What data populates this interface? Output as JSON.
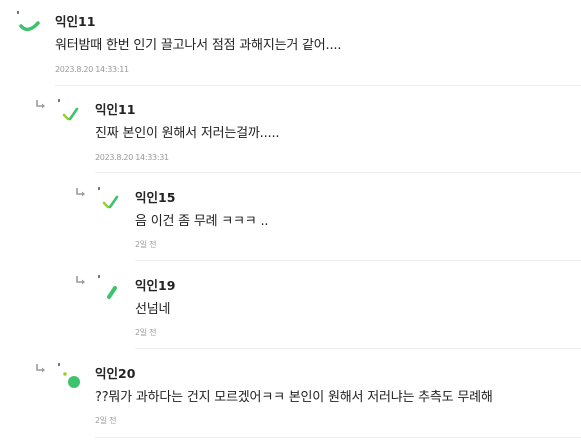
{
  "comments": [
    {
      "nickname": "익인11",
      "text": "워터밤때 한번 인기 끌고나서 점점 과해지는거 같어....",
      "time": "2023.8.20 14:33:11",
      "avatar_icon": "green-arc-avatar-icon"
    },
    {
      "nickname": "익인11",
      "text": "진짜 본인이 원해서 저러는걸까.....",
      "time": "2023.8.20 14:33:31",
      "avatar_icon": "green-dashes-avatar-icon"
    },
    {
      "nickname": "익인15",
      "text": "음 이건 좀 무례 ㅋㅋㅋ ..",
      "time": "2일 전",
      "avatar_icon": "green-dashes-avatar-icon"
    },
    {
      "nickname": "익인19",
      "text": "선넘네",
      "time": "2일 전",
      "avatar_icon": "green-bar-avatar-icon"
    },
    {
      "nickname": "익인20",
      "text": "??뭐가 과하다는 건지 모르겠어ㅋㅋ 본인이 원해서 저러냐는 추측도 무례해",
      "time": "2일 전",
      "avatar_icon": "green-dot-avatar-icon"
    }
  ],
  "reply_icon": "reply-arrow-icon",
  "colors": {
    "accent_green": "#3cc36b",
    "lime": "#9acd32",
    "meta_gray": "#9a9a9a",
    "divider": "#eeeeee"
  }
}
